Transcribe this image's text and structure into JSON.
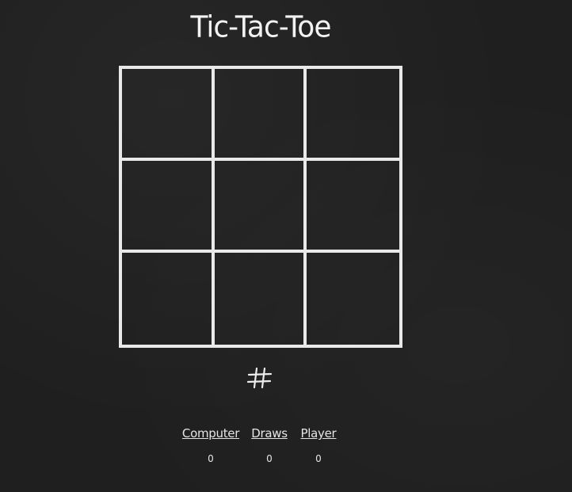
{
  "game": {
    "title": "Tic-Tac-Toe",
    "board": [
      "",
      "",
      "",
      "",
      "",
      "",
      "",
      "",
      ""
    ],
    "turn_indicator_icon": "hash-icon"
  },
  "scores": {
    "computer": {
      "label": "Computer",
      "value": "0"
    },
    "draws": {
      "label": "Draws",
      "value": "0"
    },
    "player": {
      "label": "Player",
      "value": "0"
    }
  },
  "colors": {
    "background": "#1f1f1f",
    "chalk": "#e9e9e9"
  }
}
